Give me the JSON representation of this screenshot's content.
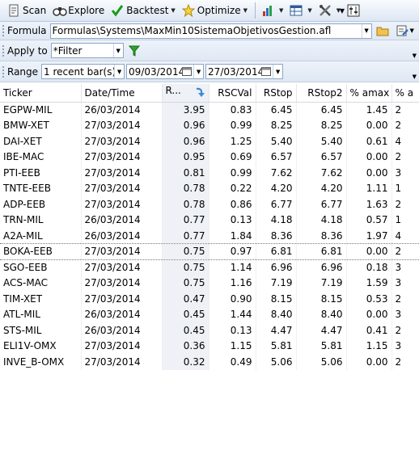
{
  "toolbar": {
    "scan": "Scan",
    "explore": "Explore",
    "backtest": "Backtest",
    "optimize": "Optimize"
  },
  "formula": {
    "label": "Formula",
    "value": "Formulas\\Systems\\MaxMin10SistemaObjetivosGestion.afl"
  },
  "apply": {
    "label": "Apply to",
    "value": "*Filter"
  },
  "range": {
    "label": "Range",
    "value": "1 recent bar(s)",
    "from": "09/03/2014",
    "to": "27/03/2014"
  },
  "table": {
    "headers": [
      "Ticker",
      "Date/Time",
      "R...",
      "RSCVal",
      "RStop",
      "RStop2",
      "% amax",
      "% a"
    ],
    "rows": [
      [
        "EGPW-MIL",
        "26/03/2014",
        "3.95",
        "0.83",
        "6.45",
        "6.45",
        "1.45",
        "2"
      ],
      [
        "BMW-XET",
        "27/03/2014",
        "0.96",
        "0.99",
        "8.25",
        "8.25",
        "0.00",
        "2"
      ],
      [
        "DAI-XET",
        "27/03/2014",
        "0.96",
        "1.25",
        "5.40",
        "5.40",
        "0.61",
        "4"
      ],
      [
        "IBE-MAC",
        "27/03/2014",
        "0.95",
        "0.69",
        "6.57",
        "6.57",
        "0.00",
        "2"
      ],
      [
        "PTI-EEB",
        "27/03/2014",
        "0.81",
        "0.99",
        "7.62",
        "7.62",
        "0.00",
        "3"
      ],
      [
        "TNTE-EEB",
        "27/03/2014",
        "0.78",
        "0.22",
        "4.20",
        "4.20",
        "1.11",
        "1"
      ],
      [
        "ADP-EEB",
        "27/03/2014",
        "0.78",
        "0.86",
        "6.77",
        "6.77",
        "1.63",
        "2"
      ],
      [
        "TRN-MIL",
        "26/03/2014",
        "0.77",
        "0.13",
        "4.18",
        "4.18",
        "0.57",
        "1"
      ],
      [
        "A2A-MIL",
        "26/03/2014",
        "0.77",
        "1.84",
        "8.36",
        "8.36",
        "1.97",
        "4"
      ],
      [
        "BOKA-EEB",
        "27/03/2014",
        "0.75",
        "0.97",
        "6.81",
        "6.81",
        "0.00",
        "2"
      ],
      [
        "SGO-EEB",
        "27/03/2014",
        "0.75",
        "1.14",
        "6.96",
        "6.96",
        "0.18",
        "3"
      ],
      [
        "ACS-MAC",
        "27/03/2014",
        "0.75",
        "1.16",
        "7.19",
        "7.19",
        "1.59",
        "3"
      ],
      [
        "TIM-XET",
        "27/03/2014",
        "0.47",
        "0.90",
        "8.15",
        "8.15",
        "0.53",
        "2"
      ],
      [
        "ATL-MIL",
        "26/03/2014",
        "0.45",
        "1.44",
        "8.40",
        "8.40",
        "0.00",
        "3"
      ],
      [
        "STS-MIL",
        "26/03/2014",
        "0.45",
        "0.13",
        "4.47",
        "4.47",
        "0.41",
        "2"
      ],
      [
        "ELI1V-OMX",
        "27/03/2014",
        "0.36",
        "1.15",
        "5.81",
        "5.81",
        "1.15",
        "3"
      ],
      [
        "INVE_B-OMX",
        "27/03/2014",
        "0.32",
        "0.49",
        "5.06",
        "5.06",
        "0.00",
        "2"
      ]
    ]
  },
  "colors": {
    "toolbar_bg": "#dde7f3",
    "sort_arrow": "#3a8ad6",
    "check_green": "#1a9b1a"
  },
  "icons": [
    "scan-icon",
    "binoculars-icon",
    "check-icon",
    "star-icon",
    "chart-icon",
    "table-icon",
    "tools-icon",
    "settings-icon",
    "folder-icon",
    "edit-icon",
    "calendar-icon",
    "filter-icon",
    "sort-icon"
  ]
}
